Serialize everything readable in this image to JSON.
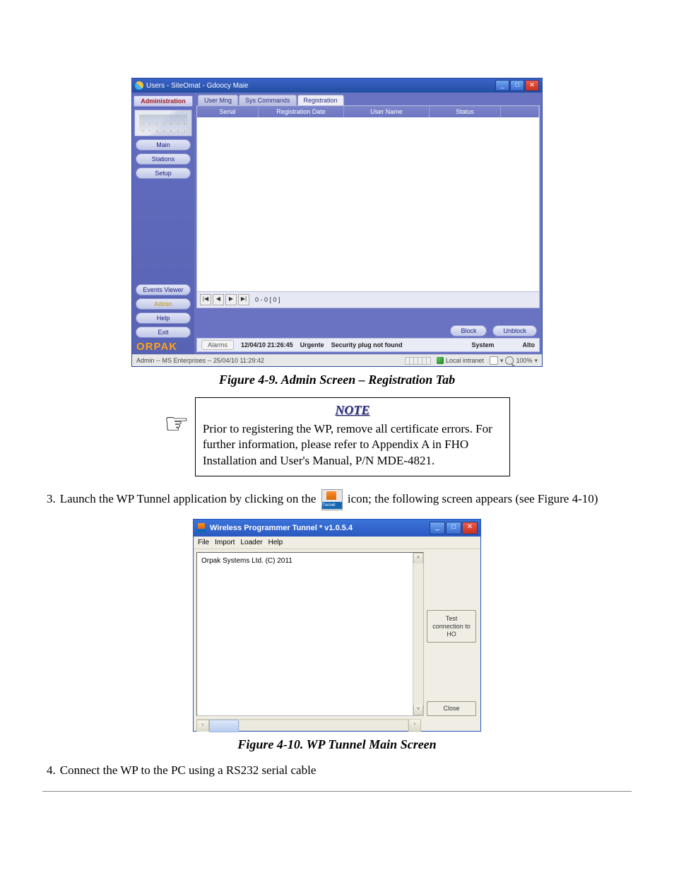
{
  "screenshot1": {
    "window_title": "Users - SiteOmat - Gdoocy Maie",
    "sidebar": {
      "heading": "Administration",
      "buttons": [
        "Main",
        "Stations",
        "Setup"
      ],
      "buttons2": [
        "Events Viewer",
        "Admin",
        "Help",
        "Exit"
      ],
      "brand": "ORPAK"
    },
    "tabs": [
      "User Mng",
      "Sys Commands",
      "Registration"
    ],
    "columns": [
      "Serial",
      "Registration Date",
      "User Name",
      "Status"
    ],
    "pager": {
      "first": "|◀",
      "prev": "◀",
      "next": "▶",
      "last": "▶|",
      "range": "0 - 0  [ 0 ]"
    },
    "action_buttons": [
      "Block",
      "Unblock"
    ],
    "alarm_row": {
      "label": "Alarms",
      "time": "12/04/10 21:26:45",
      "urgent": "Urgente",
      "msg": "Security plug not found",
      "system": "System",
      "alto": "Alto"
    },
    "statusbar": {
      "left": "Admin -- MS Enterprises -- 25/04/10  11:29:42",
      "zone": "Local intranet",
      "zoom": "100%"
    }
  },
  "caption1": "Figure 4-9. Admin Screen – Registration Tab",
  "note": {
    "title": "NOTE",
    "body": "Prior to registering the WP, remove all certificate errors. For further information, please refer to Appendix A in FHO Installation and User's Manual, P/N MDE-4821."
  },
  "step3": {
    "num": "3.",
    "before_icon": "Launch the WP Tunnel application by clicking on the ",
    "after_icon": " icon; the following screen appears (see Figure 4-10)",
    "wp_label": "WPTunnel"
  },
  "screenshot2": {
    "title": "Wireless Programmer Tunnel * v1.0.5.4",
    "menus": [
      "File",
      "Import",
      "Loader",
      "Help"
    ],
    "message": "Orpak Systems Ltd. (C) 2011",
    "test_btn": "Test connection to HO",
    "close_btn": "Close"
  },
  "caption2": "Figure 4-10. WP Tunnel Main Screen",
  "step4": {
    "num": "4.",
    "text": "Connect the WP to the PC using a RS232 serial cable"
  }
}
